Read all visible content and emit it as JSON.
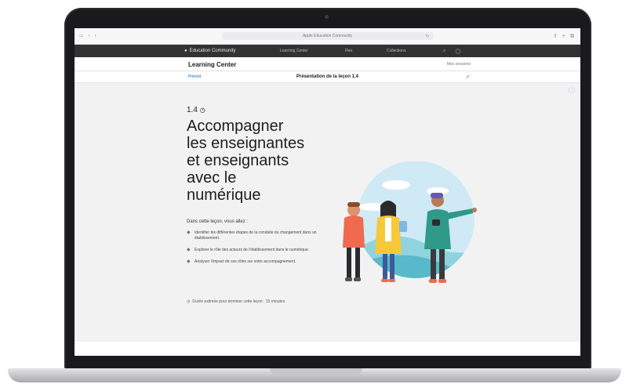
{
  "browser": {
    "url": "Apple Education Community",
    "left_icons": [
      "sidebar-icon",
      "back-icon",
      "forward-icon"
    ],
    "right_icons": [
      "share-icon",
      "new-tab-icon",
      "tabs-icon"
    ]
  },
  "community_nav": {
    "brand": "Education Community",
    "links": [
      "Learning Center",
      "Flex",
      "Collections",
      "Profile"
    ]
  },
  "learning_center": {
    "title": "Learning Center",
    "right_link": "Mes sessions"
  },
  "lesson_bar": {
    "prev": "Précéd.",
    "title": "Présentation de la leçon 1.4",
    "check": "✓"
  },
  "lesson": {
    "number": "1.4",
    "title_lines": [
      "Accompagner",
      "les enseignantes",
      "et enseignants",
      "avec le",
      "numérique"
    ],
    "intro": "Dans cette leçon, vous allez :",
    "objectives": [
      "Identifier les différentes étapes de la conduite du changement dans un établissement.",
      "Explorer le rôle des acteurs de l'établissement dans le numérique.",
      "Analyser l'impact de ces rôles sur votre accompagnement."
    ],
    "footer": "Durée estimée pour terminer cette leçon : 15 minutes"
  },
  "colors": {
    "accent": "#0066cc",
    "nav_bg": "#323234",
    "sky": "#cfeaf4",
    "hill": "#57b9c9"
  }
}
